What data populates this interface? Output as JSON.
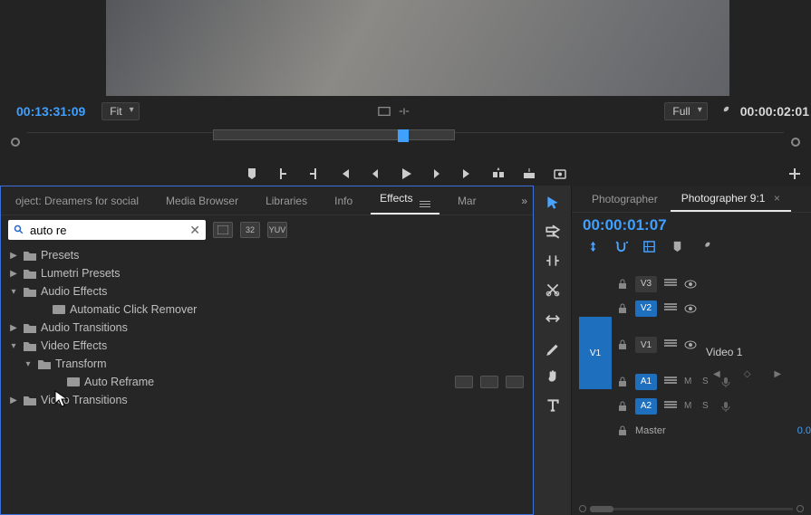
{
  "monitor": {
    "timecode_left": "00:13:31:09",
    "timecode_right": "00:00:02:01",
    "zoom_label": "Fit",
    "resolution_label": "Full"
  },
  "project_panel": {
    "tabs": {
      "project": "oject: Dreamers for social",
      "media_browser": "Media Browser",
      "libraries": "Libraries",
      "info": "Info",
      "effects": "Effects",
      "markers": "Mar"
    },
    "search_value": "auto re",
    "tree": {
      "presets": "Presets",
      "lumetri_presets": "Lumetri Presets",
      "audio_effects": "Audio Effects",
      "automatic_click_remover": "Automatic Click Remover",
      "audio_transitions": "Audio Transitions",
      "video_effects": "Video Effects",
      "transform": "Transform",
      "auto_reframe": "Auto Reframe",
      "video_transitions": "Video Transitions"
    }
  },
  "timeline": {
    "tabs": {
      "photographer": "Photographer",
      "photographer_ratio": "Photographer 9:1"
    },
    "timecode": "00:00:01:07",
    "tracks": {
      "v3": "V3",
      "v2": "V2",
      "v1": "V1",
      "v1_left": "V1",
      "a1": "A1",
      "a2": "A2",
      "master": "Master"
    },
    "clip_label": "Video 1",
    "mute": "M",
    "solo": "S",
    "master_value": "0.0"
  }
}
